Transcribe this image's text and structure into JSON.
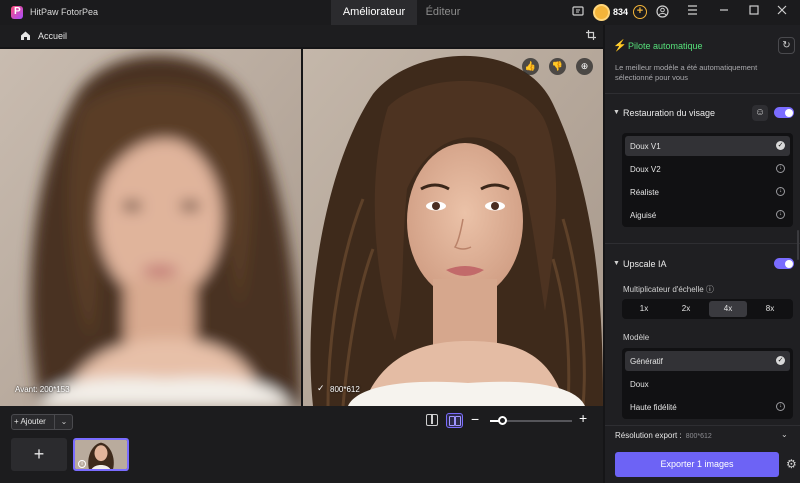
{
  "app": {
    "title": "HitPaw FotorPea",
    "tabs": [
      "Améliorateur",
      "Éditeur"
    ],
    "credits": "834"
  },
  "breadcrumb": {
    "label": "Accueil"
  },
  "preview": {
    "before_label": "Avant: 200*153",
    "after_label": "800*612"
  },
  "bottom": {
    "add_label": "+ Ajouter",
    "add_tile": "+",
    "zoom_level": 0.15
  },
  "panel": {
    "auto": {
      "title": "Pilote automatique",
      "description": "Le meilleur modèle a été automatiquement sélectionné pour vous"
    },
    "face": {
      "title": "Restauration du visage",
      "options": [
        {
          "label": "Doux V1",
          "state": "selected"
        },
        {
          "label": "Doux V2",
          "state": "download"
        },
        {
          "label": "Réaliste",
          "state": "download"
        },
        {
          "label": "Aiguisé",
          "state": "download"
        }
      ]
    },
    "upscale": {
      "title": "Upscale IA",
      "multiplier_label": "Multiplicateur d'échelle",
      "multipliers": [
        "1x",
        "2x",
        "4x",
        "8x"
      ],
      "selected_multiplier": "4x",
      "model_label": "Modèle",
      "models": [
        {
          "label": "Génératif",
          "state": "selected"
        },
        {
          "label": "Doux",
          "state": "none"
        },
        {
          "label": "Haute fidélité",
          "state": "download"
        }
      ]
    },
    "export": {
      "resolution_label": "Résolution export :",
      "resolution_value": "800*612",
      "button": "Exporter 1 images"
    }
  },
  "colors": {
    "accent": "#6d63f5",
    "auto_green": "#56e07a"
  }
}
